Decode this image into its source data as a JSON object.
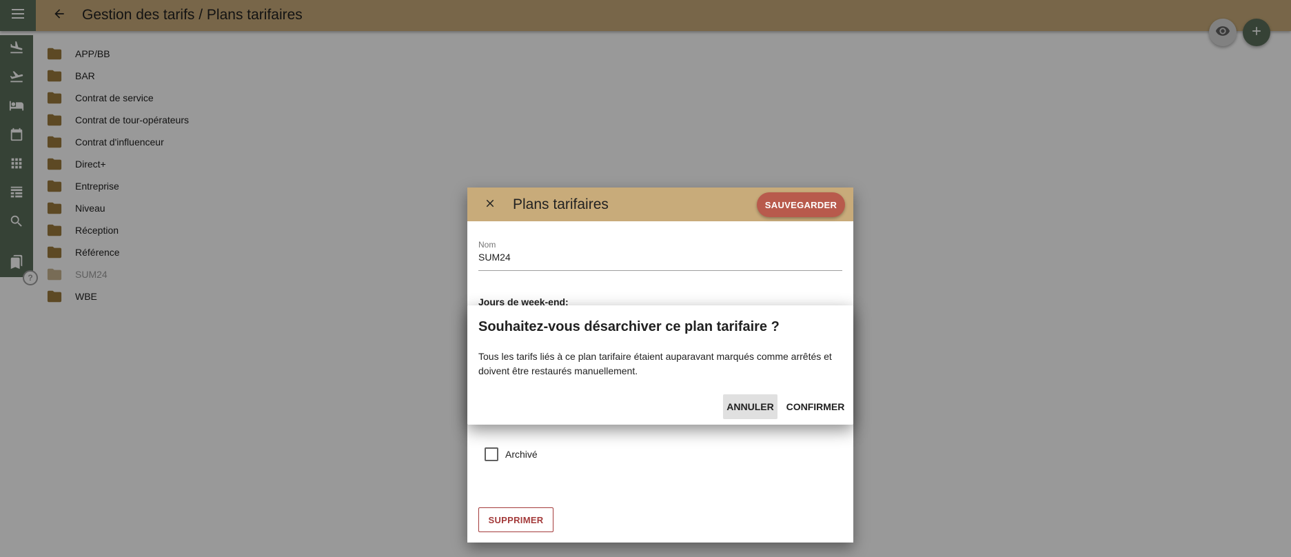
{
  "appbar": {
    "menu_icon": "menu-icon",
    "back_icon": "arrow-back-icon",
    "title": "Gestion des tarifs / Plans tarifaires",
    "color": "#c8ab7a"
  },
  "fabs": {
    "view_icon": "eye-icon",
    "add_icon": "plus-icon"
  },
  "rail": {
    "color": "#5b6e5a",
    "items": [
      {
        "icon": "flight-land-icon"
      },
      {
        "icon": "flight-takeoff-icon"
      },
      {
        "icon": "bed-icon"
      },
      {
        "icon": "calendar-icon"
      },
      {
        "icon": "grid-icon"
      },
      {
        "icon": "table-icon"
      },
      {
        "icon": "search-icon"
      },
      {
        "icon": "bookmarks-icon"
      }
    ],
    "help_label": "?"
  },
  "folders": [
    {
      "label": "APP/BB"
    },
    {
      "label": "BAR"
    },
    {
      "label": "Contrat de service"
    },
    {
      "label": "Contrat de tour-opérateurs"
    },
    {
      "label": "Contrat d'influenceur"
    },
    {
      "label": "Direct+"
    },
    {
      "label": "Entreprise"
    },
    {
      "label": "Niveau"
    },
    {
      "label": "Réception"
    },
    {
      "label": "Référence"
    },
    {
      "label": "SUM24",
      "muted": true
    },
    {
      "label": "WBE"
    }
  ],
  "edit_dialog": {
    "title": "Plans tarifaires",
    "save_label": "SAUVEGARDER",
    "name_label": "Nom",
    "name_value": "SUM24",
    "weekend_label": "Jours de week-end:",
    "archived_label": "Archivé",
    "delete_label": "SUPPRIMER",
    "accent": "#b85a4c"
  },
  "confirm_dialog": {
    "title": "Souhaitez-vous désarchiver ce plan tarifaire ?",
    "message": "Tous les tarifs liés à ce plan tarifaire étaient auparavant marqués comme arrêtés et doivent être restaurés manuellement.",
    "cancel_label": "ANNULER",
    "confirm_label": "CONFIRMER"
  }
}
